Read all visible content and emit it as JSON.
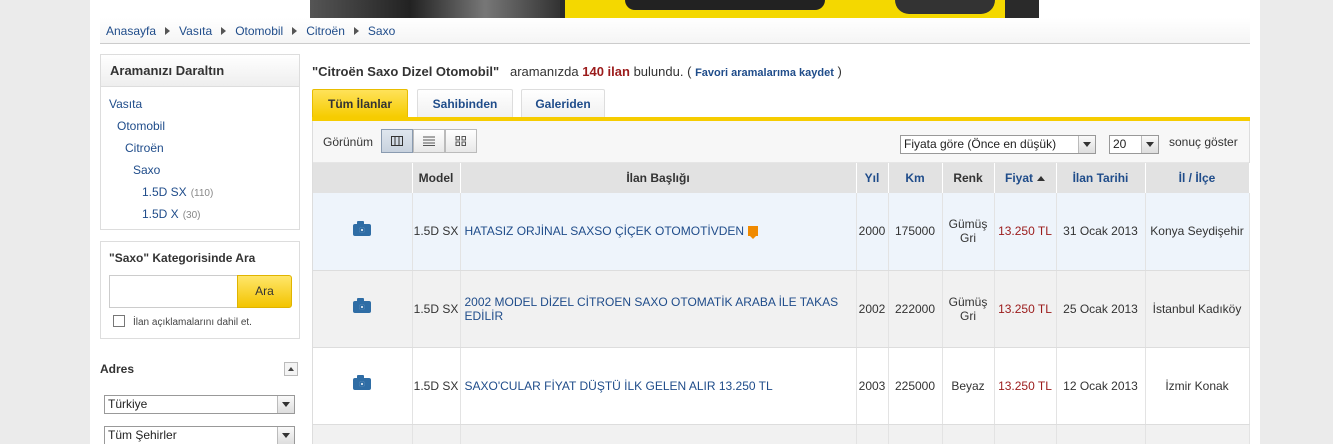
{
  "breadcrumb": [
    "Anasayfa",
    "Vasıta",
    "Otomobil",
    "Citroën",
    "Saxo"
  ],
  "refine": {
    "title": "Aramanızı Daraltın",
    "tree": [
      {
        "label": "Vasıta",
        "count": ""
      },
      {
        "label": "Otomobil",
        "count": ""
      },
      {
        "label": "Citroën",
        "count": ""
      },
      {
        "label": "Saxo",
        "count": ""
      },
      {
        "label": "1.5D SX",
        "count": "(110)"
      },
      {
        "label": "1.5D X",
        "count": "(30)"
      }
    ]
  },
  "category_search": {
    "title": "\"Saxo\" Kategorisinde Ara",
    "input_value": "",
    "button": "Ara",
    "checkbox_label": "İlan açıklamalarını dahil et."
  },
  "address": {
    "label": "Adres",
    "country": "Türkiye",
    "city": "Tüm Şehirler"
  },
  "headline": {
    "query": "\"Citroën Saxo Dizel Otomobil\"",
    "text1": "aramanızda",
    "count": "140 ilan",
    "text2": "bulundu.",
    "open": "(",
    "save_link": "Favori aramalarıma kaydet",
    "close": ")"
  },
  "tabs": [
    "Tüm İlanlar",
    "Sahibinden",
    "Galeriden"
  ],
  "toolbar": {
    "view_label": "Görünüm",
    "sort_value": "Fiyata göre (Önce en düşük)",
    "per_page": "20",
    "per_page_label": "sonuç göster"
  },
  "table": {
    "headers": [
      "",
      "Model",
      "İlan Başlığı",
      "Yıl",
      "Km",
      "Renk",
      "Fiyat",
      "İlan Tarihi",
      "İl / İlçe"
    ],
    "rows": [
      {
        "model": "1.5D SX",
        "title": "HATASIZ ORJİNAL SAXSO ÇİÇEK OTOMOTİVDEN",
        "year": "2000",
        "km": "175000",
        "color": "Gümüş Gri",
        "price": "13.250 TL",
        "date": "31 Ocak 2013",
        "place": "Konya Seydişehir"
      },
      {
        "model": "1.5D SX",
        "title": "2002 MODEL DİZEL CİTROEN SAXO OTOMATİK ARABA İLE TAKAS EDİLİR",
        "year": "2002",
        "km": "222000",
        "color": "Gümüş Gri",
        "price": "13.250 TL",
        "date": "25 Ocak 2013",
        "place": "İstanbul Kadıköy"
      },
      {
        "model": "1.5D SX",
        "title": "SAXO'CULAR FİYAT DÜŞTÜ İLK GELEN ALIR 13.250 TL",
        "year": "2003",
        "km": "225000",
        "color": "Beyaz",
        "price": "13.250 TL",
        "date": "12 Ocak 2013",
        "place": "İzmir Konak"
      }
    ]
  }
}
